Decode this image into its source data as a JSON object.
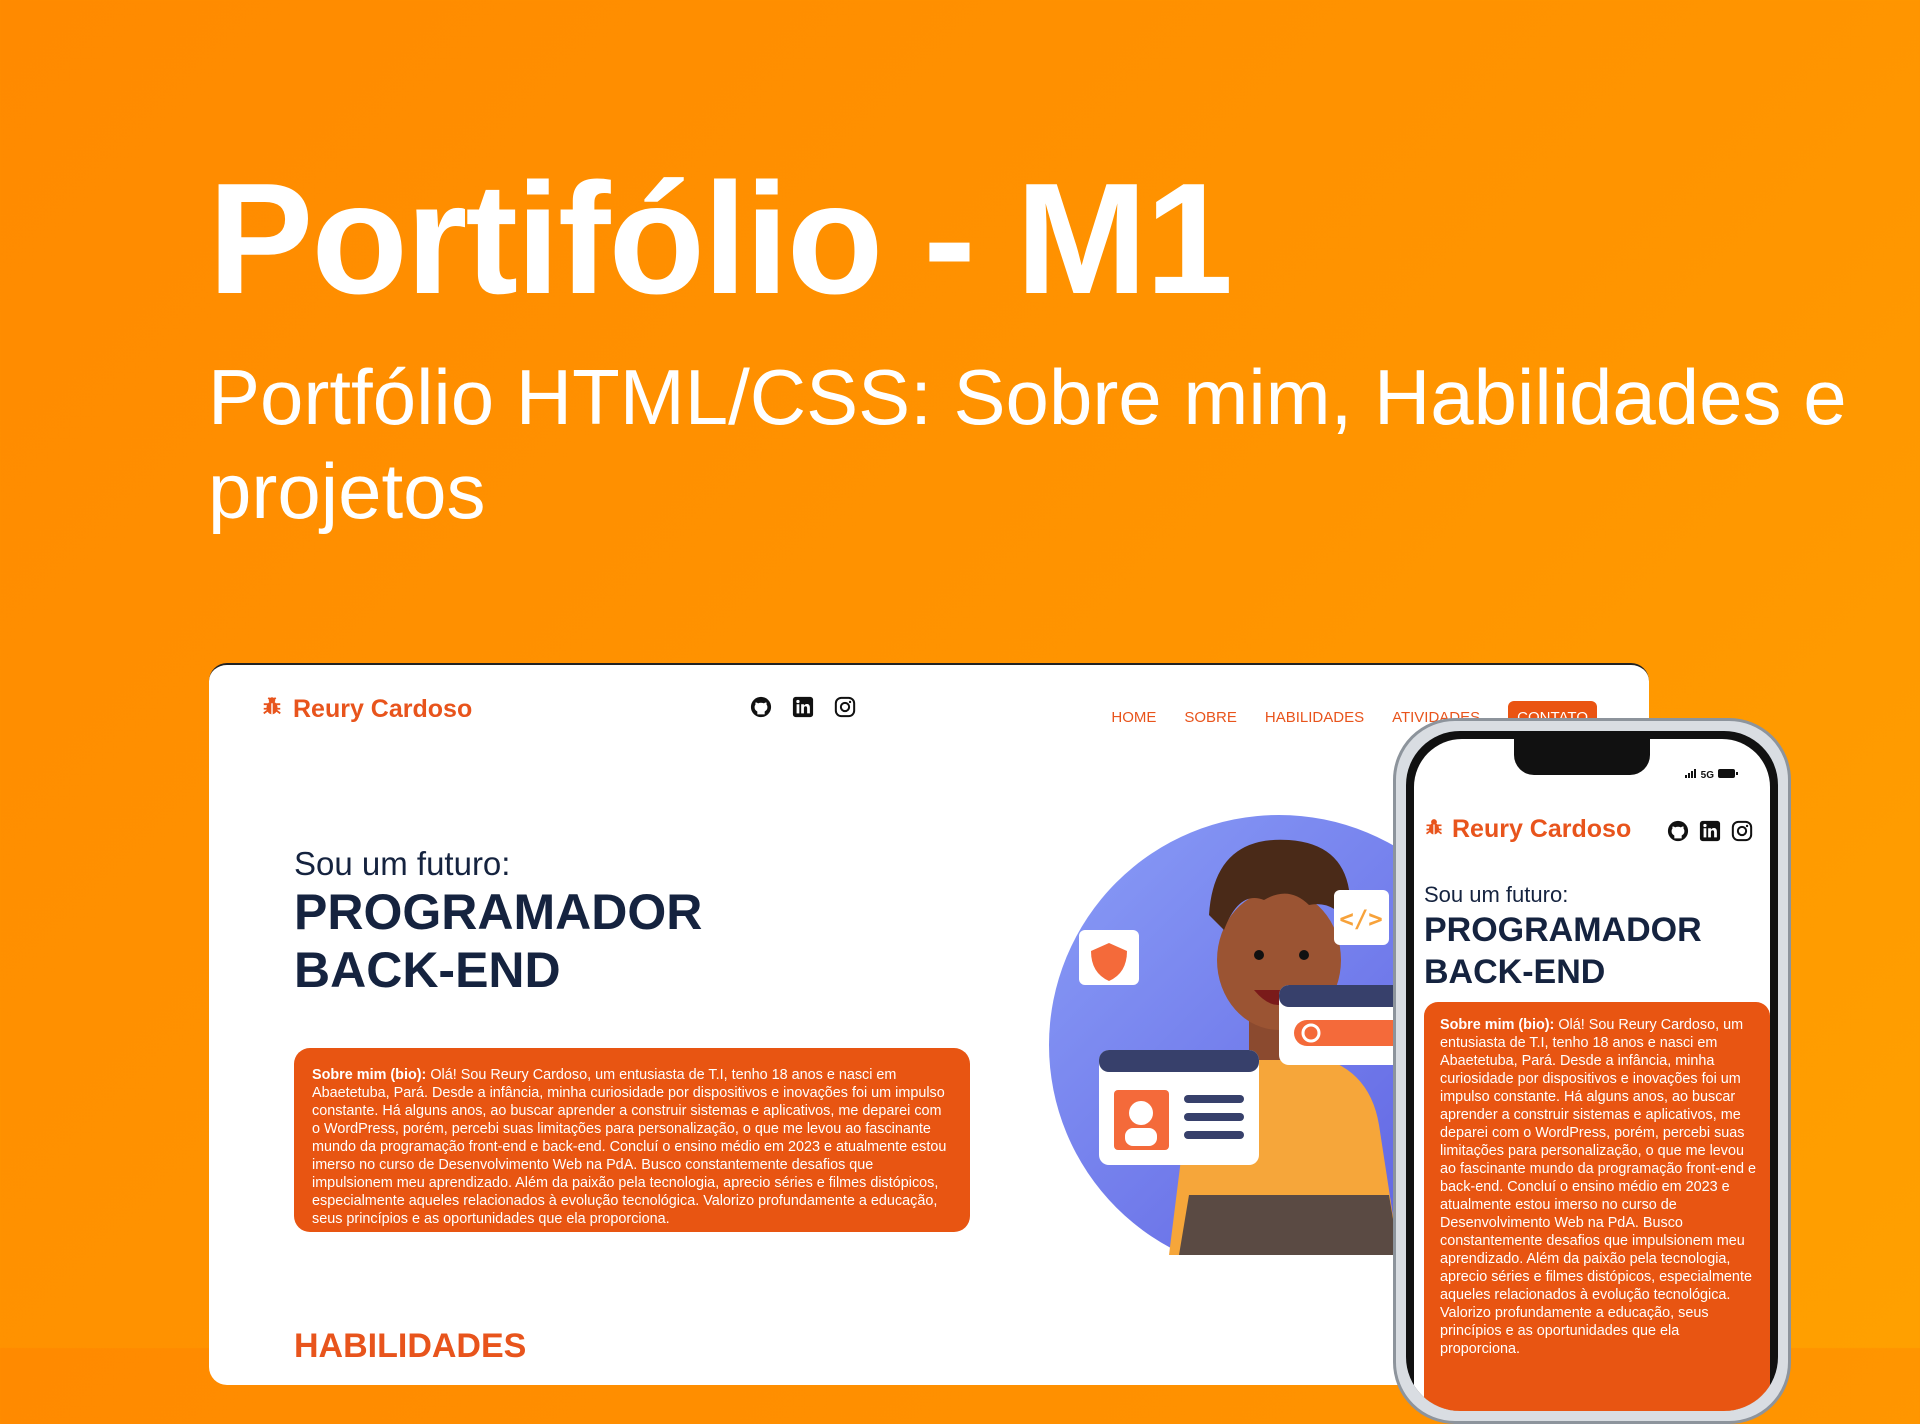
{
  "hero": {
    "title": "Portifólio - M1",
    "subtitle": "Portfólio HTML/CSS: Sobre mim, Habilidades e projetos"
  },
  "site": {
    "brand": "Reury Cardoso",
    "social_icons": [
      "github-icon",
      "linkedin-icon",
      "instagram-icon"
    ],
    "nav": [
      "HOME",
      "SOBRE",
      "HABILIDADES",
      "ATIVIDADES",
      "CONTATO"
    ],
    "kicker": "Sou um futuro:",
    "role_line1": "PROGRAMADOR",
    "role_line2": "BACK-END",
    "bio_label": "Sobre mim (bio):",
    "bio_text": " Olá! Sou Reury Cardoso, um entusiasta de T.I, tenho 18 anos e nasci em Abaetetuba, Pará. Desde a infância, minha curiosidade por dispositivos e inovações foi um impulso constante. Há alguns anos, ao buscar aprender a construir sistemas e aplicativos, me deparei com o WordPress, porém, percebi suas limitações para personalização, o que me levou ao fascinante mundo da programação front-end e back-end. Concluí o ensino médio em 2023 e atualmente estou imerso no curso de Desenvolvimento Web na PdA. Busco constantemente desafios que impulsionem meu aprendizado. Além da paixão pela tecnologia, aprecio séries e filmes distópicos, especialmente aqueles relacionados à evolução tecnológica. Valorizo profundamente a educação, seus princípios e as oportunidades que ela proporciona.",
    "skills_heading": "HABILIDADES"
  },
  "phone": {
    "status": "5G"
  },
  "colors": {
    "accent": "#e8541c",
    "navy": "#15233f",
    "background": "#ff8a00"
  }
}
